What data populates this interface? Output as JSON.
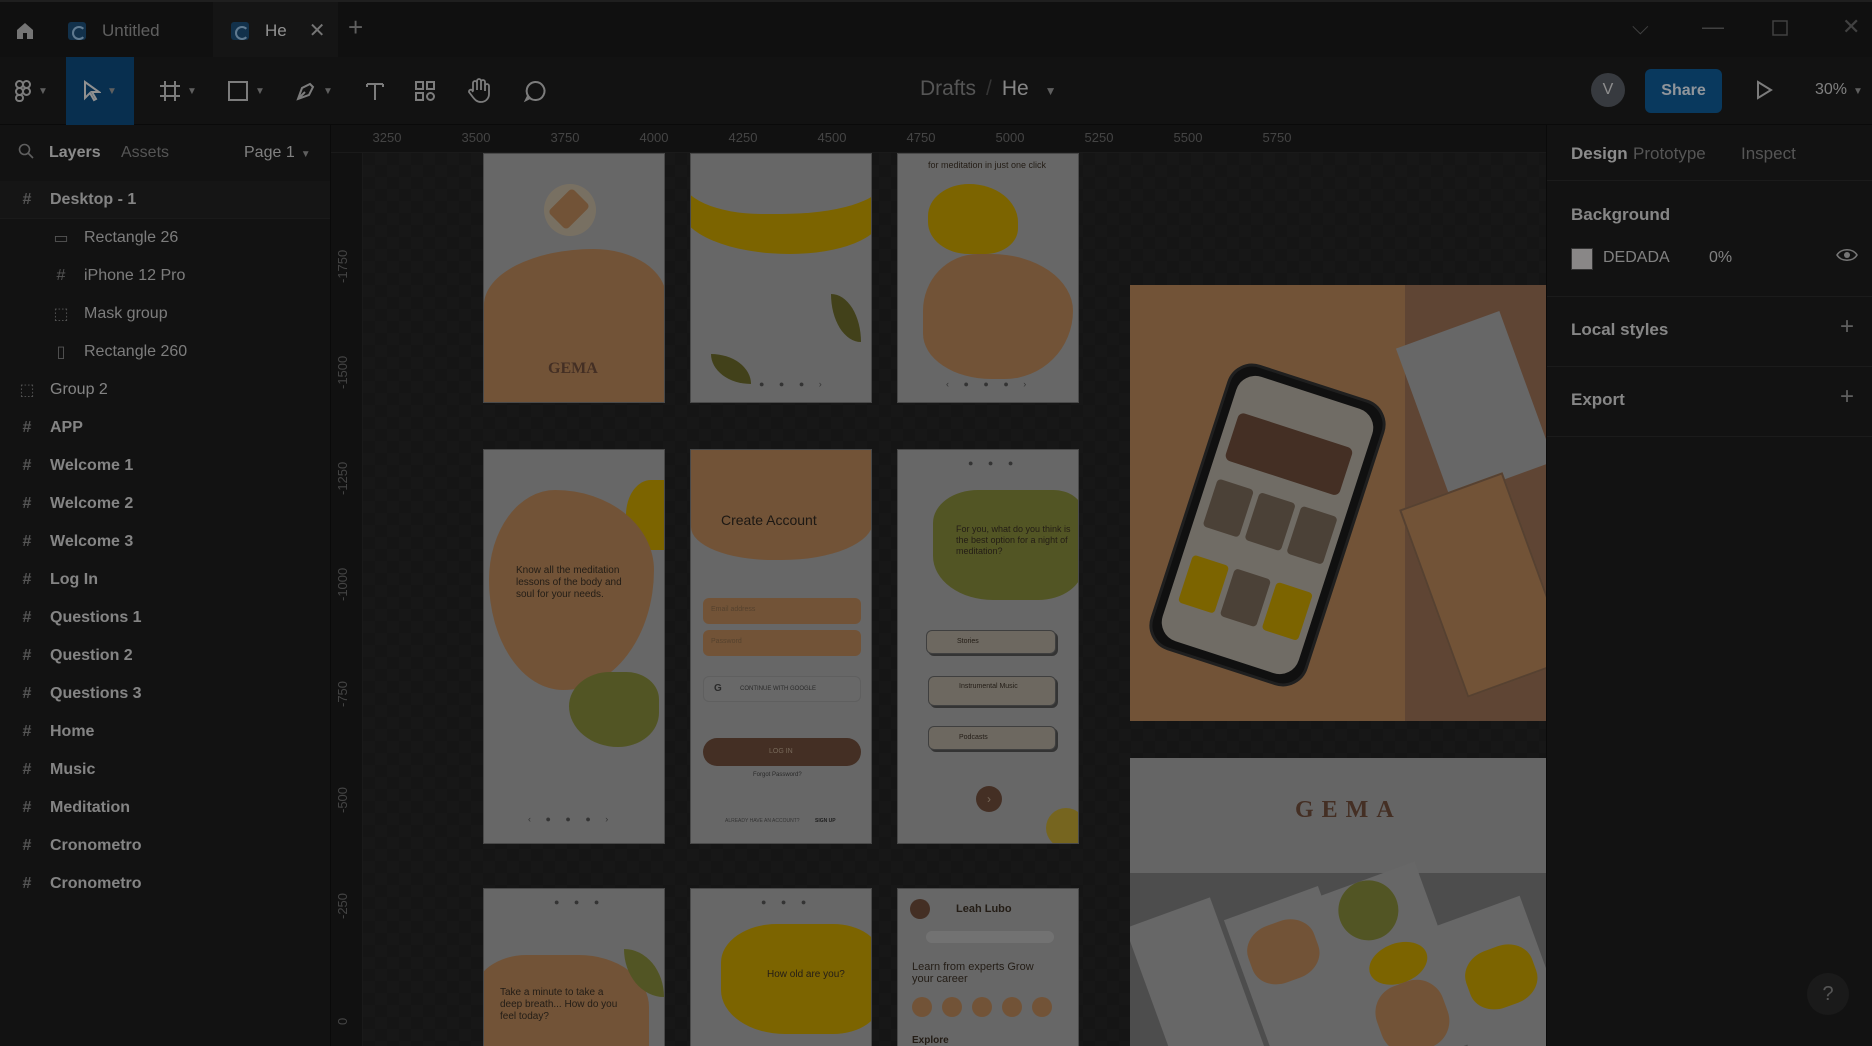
{
  "titlebar": {
    "tabs": [
      {
        "label": "Untitled"
      },
      {
        "label": "He"
      }
    ]
  },
  "toolbar": {
    "breadcrumb_folder": "Drafts",
    "breadcrumb_sep": "/",
    "breadcrumb_file": "He",
    "avatar_initial": "V",
    "share_label": "Share",
    "zoom_label": "30%"
  },
  "leftpanel": {
    "tab_layers": "Layers",
    "tab_assets": "Assets",
    "page_label": "Page 1",
    "layers": [
      {
        "label": "Desktop - 1",
        "kind": "frame-top"
      },
      {
        "label": "Rectangle 26",
        "kind": "rect"
      },
      {
        "label": "iPhone 12 Pro",
        "kind": "frame-child"
      },
      {
        "label": "Mask group",
        "kind": "group-child"
      },
      {
        "label": "Rectangle 260",
        "kind": "rect-outline"
      },
      {
        "label": "Group 2",
        "kind": "group"
      },
      {
        "label": "APP",
        "kind": "frame"
      },
      {
        "label": "Welcome 1",
        "kind": "frame"
      },
      {
        "label": "Welcome 2",
        "kind": "frame"
      },
      {
        "label": "Welcome 3",
        "kind": "frame"
      },
      {
        "label": "Log In",
        "kind": "frame"
      },
      {
        "label": "Questions 1",
        "kind": "frame"
      },
      {
        "label": "Question 2",
        "kind": "frame"
      },
      {
        "label": "Questions 3",
        "kind": "frame"
      },
      {
        "label": "Home",
        "kind": "frame"
      },
      {
        "label": "Music",
        "kind": "frame"
      },
      {
        "label": "Meditation",
        "kind": "frame"
      },
      {
        "label": "Cronometro",
        "kind": "frame"
      },
      {
        "label": "Cronometro",
        "kind": "frame"
      }
    ]
  },
  "ruler": {
    "h": [
      "3250",
      "3500",
      "3750",
      "4000",
      "4250",
      "4500",
      "4750",
      "5000",
      "5250",
      "5500",
      "5750"
    ],
    "v": [
      "-1750",
      "-1500",
      "-1250",
      "-1000",
      "-750",
      "-500",
      "-250",
      "0"
    ]
  },
  "canvas": {
    "gema_logo": "GEMA",
    "meditation_click": "for meditation in just one click",
    "know_text": "Know all the meditation lessons of the body and soul for your needs.",
    "create_account": "Create Account",
    "email_ph": "Email address",
    "password_ph": "Password",
    "continue_google": "CONTINUE WITH GOOGLE",
    "log_in": "LOG IN",
    "forgot": "Forgot Password?",
    "already": "ALREADY HAVE AN ACCOUNT?",
    "sign_up": "SIGN UP",
    "question_text": "For you, what do you think is the best option for a night of meditation?",
    "opt_stories": "Stories",
    "opt_instrumental": "Instrumental Music",
    "opt_podcasts": "Podcasts",
    "take_minute": "Take a minute to take a deep breath... How do you feel today?",
    "how_old": "How old are you?",
    "user_name": "Leah Lubo",
    "learn": "Learn from experts Grow your career",
    "explore": "Explore",
    "brand_banner": "GEMA"
  },
  "rightpanel": {
    "tab_design": "Design",
    "tab_prototype": "Prototype",
    "tab_inspect": "Inspect",
    "background_title": "Background",
    "bg_hex": "DEDADA",
    "bg_opacity": "0%",
    "local_styles": "Local styles",
    "export": "Export"
  },
  "colors": {
    "accent": "#0d4d80",
    "tan": "#b8875a",
    "mustard": "#c9a200",
    "olive": "#858a3a",
    "brown": "#6e4c3a"
  }
}
